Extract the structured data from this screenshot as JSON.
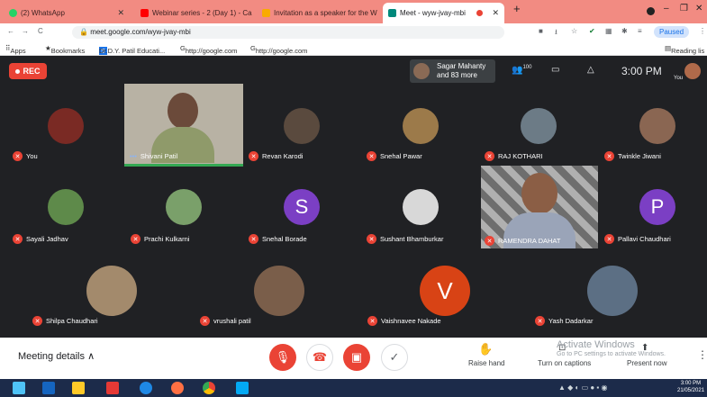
{
  "tabs": [
    {
      "label": "(2) WhatsApp",
      "color": "#25d366"
    },
    {
      "label": "Webinar series - 2 (Day 1) - Care",
      "color": "#ff0000"
    },
    {
      "label": "Invitation as a speaker for the W",
      "color": "#f9ab00"
    },
    {
      "label": "Meet - wyw-jvay-mbi",
      "color": "#00897b"
    }
  ],
  "address": {
    "url": "meet.google.com/wyw-jvay-mbi",
    "paused": "Paused"
  },
  "bookmarks": {
    "apps": "Apps",
    "bookmarks": "Bookmarks",
    "b1": "Dr.D.Y. Patil Educati...",
    "b2": "http://google.com",
    "b3": "http://google.com",
    "reading": "Reading lis"
  },
  "meet": {
    "rec": "REC",
    "presenter_line1": "Sagar Mahanty",
    "presenter_line2": "and 83 more",
    "participant_count": "100",
    "time": "3:00 PM",
    "self_label": "You"
  },
  "participants": [
    {
      "name": "You",
      "initial": ""
    },
    {
      "name": "Shivani Patil",
      "initial": ""
    },
    {
      "name": "Revan Karodi",
      "initial": ""
    },
    {
      "name": "Snehal Pawar",
      "initial": ""
    },
    {
      "name": "RAJ KOTHARI",
      "initial": ""
    },
    {
      "name": "Twinkle Jiwani",
      "initial": ""
    },
    {
      "name": "Sayali Jadhav",
      "initial": ""
    },
    {
      "name": "Prachi Kulkarni",
      "initial": ""
    },
    {
      "name": "Snehal Borade",
      "initial": "S"
    },
    {
      "name": "Sushant Bhamburkar",
      "initial": ""
    },
    {
      "name": "RAMENDRA DAHAT",
      "initial": ""
    },
    {
      "name": "Pallavi Chaudhari",
      "initial": "P"
    },
    {
      "name": "Shilpa Chaudhari",
      "initial": ""
    },
    {
      "name": "vrushali patil",
      "initial": ""
    },
    {
      "name": "Vaishnavee Nakade",
      "initial": "V"
    },
    {
      "name": "Yash Dadarkar",
      "initial": ""
    }
  ],
  "bottom": {
    "meeting_details": "Meeting details",
    "raise_hand": "Raise hand",
    "captions": "Turn on captions",
    "present": "Present now",
    "watermark1": "Activate Windows",
    "watermark2": "Go to PC settings to activate Windows."
  },
  "taskbar": {
    "time": "3:00 PM",
    "date": "21/05/2021"
  }
}
